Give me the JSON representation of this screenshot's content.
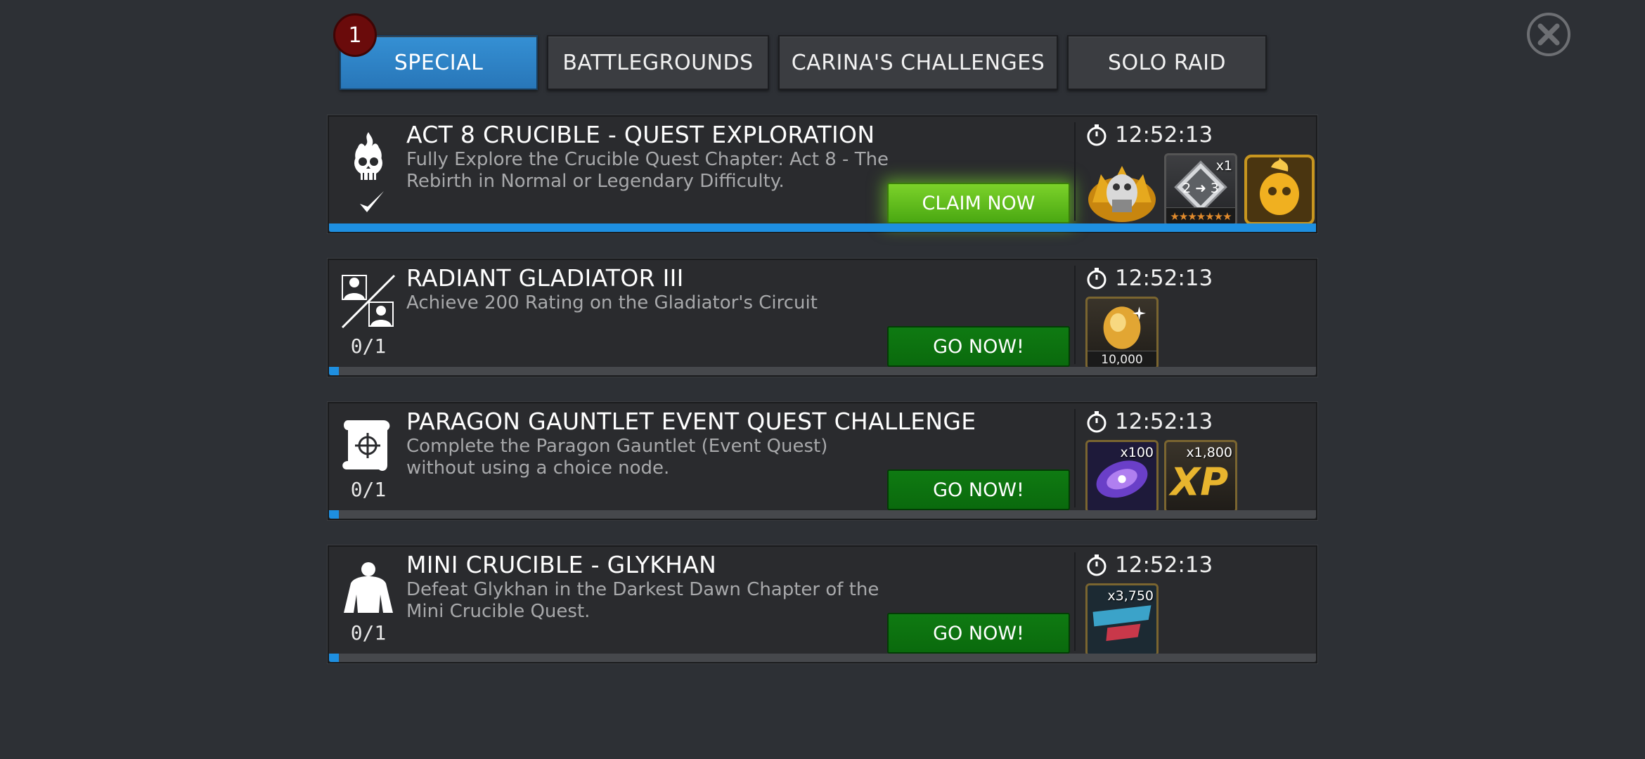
{
  "tabs": [
    {
      "label": "SPECIAL",
      "active": true,
      "badge": "1"
    },
    {
      "label": "BATTLEGROUNDS",
      "active": false
    },
    {
      "label": "CARINA'S CHALLENGES",
      "active": false
    },
    {
      "label": "SOLO RAID",
      "active": false
    }
  ],
  "quests": [
    {
      "icon": "flaming-skull-icon",
      "title": "ACT 8 CRUCIBLE - QUEST EXPLORATION",
      "description": "Fully Explore the Crucible Quest Chapter: Act 8 - The Rebirth in Normal or Legendary Difficulty.",
      "progress_text": "",
      "completed": true,
      "button": "CLAIM NOW",
      "progress_fraction": 1.0,
      "timer": "12:52:13",
      "rewards": [
        {
          "icon": "crystal-reward-icon",
          "qty": "",
          "label": ""
        },
        {
          "icon": "rank-up-gem-icon",
          "qty": "x1",
          "label": "★★★★★★★",
          "rank_text": "2 ➜ 3"
        },
        {
          "icon": "flaming-skull-crystal-icon",
          "qty": "",
          "label": ""
        }
      ]
    },
    {
      "icon": "gladiator-duel-icon",
      "title": "RADIANT GLADIATOR III",
      "description": "Achieve 200 Rating on the Gladiator's Circuit",
      "progress_text": "0/1",
      "completed": false,
      "button": "GO NOW!",
      "progress_fraction": 0.01,
      "timer": "12:52:13",
      "rewards": [
        {
          "icon": "gold-crystal-icon",
          "qty": "",
          "label": "10,000"
        }
      ]
    },
    {
      "icon": "scroll-target-icon",
      "title": "PARAGON GAUNTLET EVENT QUEST CHALLENGE",
      "description": "Complete the Paragon Gauntlet (Event Quest) without using a choice node.",
      "progress_text": "0/1",
      "completed": false,
      "button": "GO NOW!",
      "progress_fraction": 0.01,
      "timer": "12:52:13",
      "rewards": [
        {
          "icon": "galaxy-icon",
          "qty": "x100",
          "label": ""
        },
        {
          "icon": "xp-icon",
          "qty": "x1,800",
          "label": ""
        }
      ]
    },
    {
      "icon": "hero-silhouette-icon",
      "title": "MINI CRUCIBLE - GLYKHAN",
      "description": "Defeat Glykhan in the Darkest Dawn Chapter of the Mini Crucible Quest.",
      "progress_text": "0/1",
      "completed": false,
      "button": "GO NOW!",
      "progress_fraction": 0.01,
      "timer": "12:52:13",
      "rewards": [
        {
          "icon": "summoners-fest-icon",
          "qty": "x3,750",
          "label": ""
        }
      ]
    }
  ],
  "close_icon": "close-icon",
  "colors": {
    "active_tab": "#2f86c8",
    "progress": "#1e8fe0",
    "go_button": "#0b6e0e",
    "claim_button": "#66c21f",
    "badge": "#6a0b0b"
  }
}
